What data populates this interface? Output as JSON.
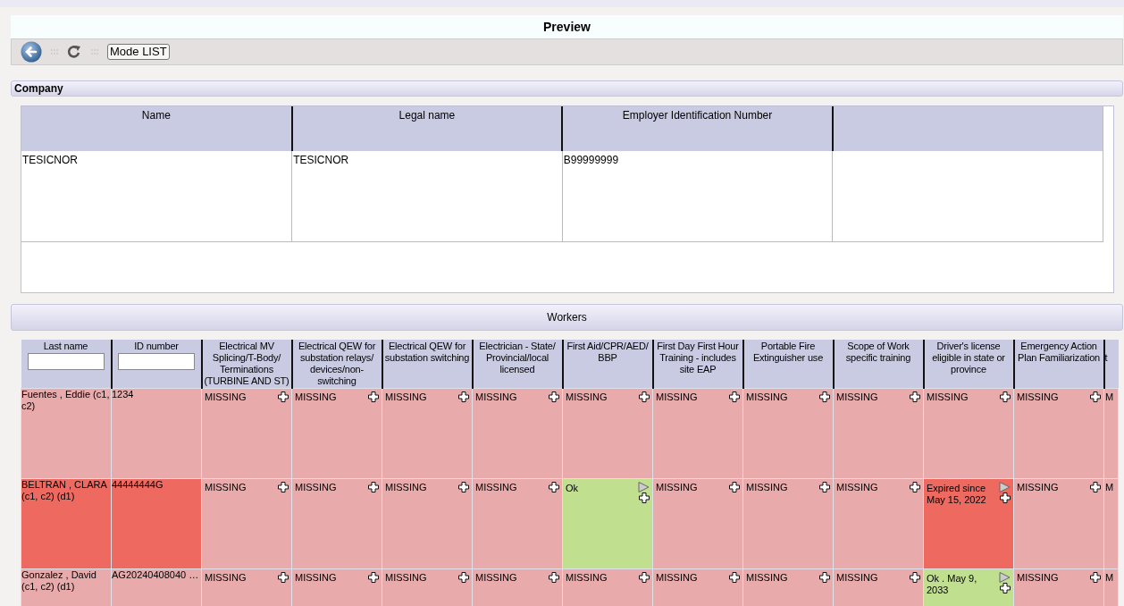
{
  "window": {
    "title": "Preview"
  },
  "toolbar": {
    "mode_button": "Mode LIST"
  },
  "company": {
    "section_title": "Company",
    "columns": [
      "Name",
      "Legal name",
      "Employer Identification Number"
    ],
    "rows": [
      [
        "TESICNOR",
        "TESICNOR",
        "B99999999"
      ]
    ]
  },
  "workers": {
    "section_title": "Workers",
    "columns": [
      {
        "label": "Last name",
        "kind": "filter"
      },
      {
        "label": "ID number",
        "kind": "filter"
      },
      {
        "label": "Electrical MV Splicing/T-Body/ Terminations (TURBINE AND ST)",
        "kind": "plain"
      },
      {
        "label": "Electrical QEW for substation relays/ devices/non-switching",
        "kind": "plain"
      },
      {
        "label": "Electrical QEW for substation switching",
        "kind": "plain"
      },
      {
        "label": "Electrician - State/ Provincial/local licensed",
        "kind": "plain"
      },
      {
        "label": "First Aid/CPR/AED/ BBP",
        "kind": "plain"
      },
      {
        "label": "First Day First Hour Training - includes site EAP",
        "kind": "plain"
      },
      {
        "label": "Portable Fire Extinguisher use",
        "kind": "plain"
      },
      {
        "label": "Scope of Work specific training",
        "kind": "plain"
      },
      {
        "label": "Driver's license eligible in state or province",
        "kind": "plain"
      },
      {
        "label": "Emergency Action Plan Familiarization",
        "kind": "plain"
      },
      {
        "label": "t",
        "kind": "cut"
      }
    ],
    "rows": [
      {
        "flagged": false,
        "cells": [
          {
            "kind": "name",
            "text": "Fuentes , Eddie (c1, c2)"
          },
          {
            "kind": "id",
            "text": "1234"
          },
          {
            "kind": "missing",
            "text": "MISSING"
          },
          {
            "kind": "missing",
            "text": "MISSING"
          },
          {
            "kind": "missing",
            "text": "MISSING"
          },
          {
            "kind": "missing",
            "text": "MISSING"
          },
          {
            "kind": "missing",
            "text": "MISSING"
          },
          {
            "kind": "missing",
            "text": "MISSING"
          },
          {
            "kind": "missing",
            "text": "MISSING"
          },
          {
            "kind": "missing",
            "text": "MISSING"
          },
          {
            "kind": "missing",
            "text": "MISSING"
          },
          {
            "kind": "missing",
            "text": "MISSING"
          },
          {
            "kind": "cut",
            "text": "M"
          }
        ]
      },
      {
        "flagged": true,
        "cells": [
          {
            "kind": "name",
            "text": "BELTRAN , CLARA (c1, c2) (d1)"
          },
          {
            "kind": "id",
            "text": "44444444G"
          },
          {
            "kind": "missing",
            "text": "MISSING"
          },
          {
            "kind": "missing",
            "text": "MISSING"
          },
          {
            "kind": "missing",
            "text": "MISSING"
          },
          {
            "kind": "missing",
            "text": "MISSING"
          },
          {
            "kind": "ok",
            "text": "Ok"
          },
          {
            "kind": "missing",
            "text": "MISSING"
          },
          {
            "kind": "missing",
            "text": "MISSING"
          },
          {
            "kind": "missing",
            "text": "MISSING"
          },
          {
            "kind": "expired",
            "text": "Expired since May 15, 2022"
          },
          {
            "kind": "missing",
            "text": "MISSING"
          },
          {
            "kind": "cut",
            "text": "M"
          }
        ]
      },
      {
        "flagged": false,
        "cells": [
          {
            "kind": "name",
            "text": "Gonzalez , David (c1, c2) (d1)"
          },
          {
            "kind": "id",
            "text": "AG20240408040 …"
          },
          {
            "kind": "missing",
            "text": "MISSING"
          },
          {
            "kind": "missing",
            "text": "MISSING"
          },
          {
            "kind": "missing",
            "text": "MISSING"
          },
          {
            "kind": "missing",
            "text": "MISSING"
          },
          {
            "kind": "missing",
            "text": "MISSING"
          },
          {
            "kind": "missing",
            "text": "MISSING"
          },
          {
            "kind": "missing",
            "text": "MISSING"
          },
          {
            "kind": "missing",
            "text": "MISSING"
          },
          {
            "kind": "ok",
            "text": "Ok . May 9, 2033"
          },
          {
            "kind": "missing",
            "text": "MISSING"
          },
          {
            "kind": "cut",
            "text": "M"
          }
        ]
      }
    ]
  }
}
